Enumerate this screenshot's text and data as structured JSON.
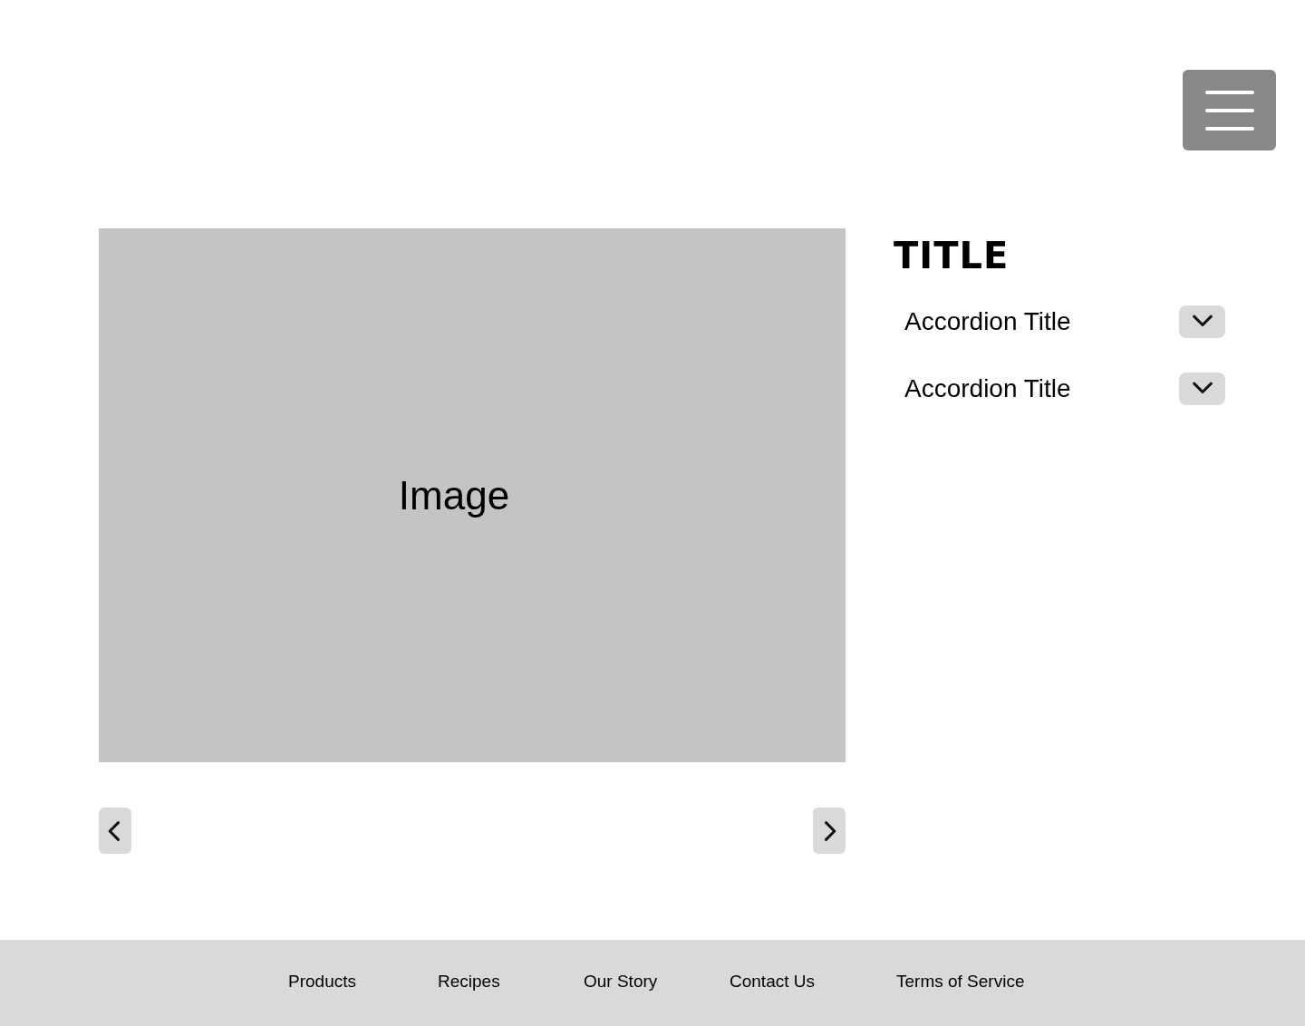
{
  "gallery": {
    "image_label": "Image"
  },
  "details": {
    "title": "TITLE",
    "accordion": [
      {
        "title": "Accordion Title",
        "expanded": false
      },
      {
        "title": "Accordion Title",
        "expanded": false
      }
    ]
  },
  "footer": {
    "links": [
      "Products",
      "Recipes",
      "Our Story",
      "Contact Us",
      "Terms of Service"
    ]
  }
}
